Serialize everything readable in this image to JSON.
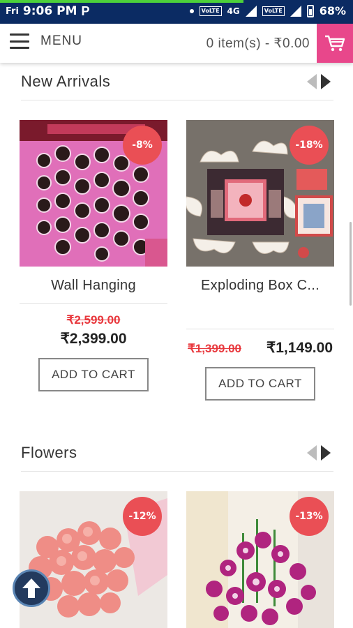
{
  "status_bar": {
    "day": "Fri",
    "time": "9:06 PM",
    "app_badge": "P",
    "network_1": "VoLTE",
    "network_type": "4G",
    "network_2": "VoLTE",
    "battery": "68%",
    "page_load_progress": 0.69
  },
  "header": {
    "menu_label": "MENU",
    "cart_summary": "0 item(s) - ₹0.00"
  },
  "sections": [
    {
      "title": "New Arrivals",
      "products": [
        {
          "name": "Wall Hanging",
          "discount": "-8%",
          "old_price": "₹2,599.00",
          "price": "₹2,399.00",
          "button": "ADD TO CART"
        },
        {
          "name": "Exploding Box C...",
          "discount": "-18%",
          "old_price": "₹1,399.00",
          "price": "₹1,149.00",
          "button": "ADD TO CART"
        }
      ]
    },
    {
      "title": "Flowers",
      "products": [
        {
          "discount": "-12%"
        },
        {
          "discount": "-13%"
        }
      ]
    }
  ],
  "colors": {
    "status_bar": "#0b2b63",
    "cart_button": "#e8478b",
    "discount_badge": "#ea4f55",
    "old_price": "#e8383d"
  },
  "icons": [
    "hamburger-icon",
    "cart-icon",
    "arrow-left-icon",
    "arrow-right-icon",
    "scroll-top-icon"
  ]
}
